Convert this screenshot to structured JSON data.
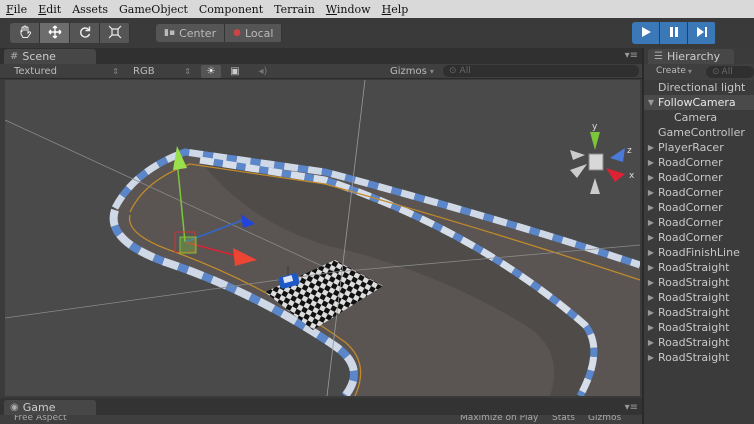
{
  "menu": [
    {
      "key": "F",
      "rest": "ile"
    },
    {
      "key": "E",
      "rest": "dit"
    },
    {
      "key": "",
      "rest": "Assets"
    },
    {
      "key": "",
      "rest": "GameObject"
    },
    {
      "key": "",
      "rest": "Component"
    },
    {
      "key": "",
      "rest": "Terrain"
    },
    {
      "key": "W",
      "rest": "indow"
    },
    {
      "key": "H",
      "rest": "elp"
    }
  ],
  "toolbar": {
    "tools": [
      "hand-icon",
      "move-icon",
      "rotate-icon",
      "scale-icon"
    ],
    "active_tool": "move-icon",
    "pivot": {
      "center_label": "Center",
      "local_label": "Local"
    },
    "play_controls": [
      "play-icon",
      "pause-icon",
      "step-icon"
    ],
    "accent": "#3a78b8"
  },
  "scene": {
    "tab_label": "Scene",
    "render_mode": "Textured",
    "color_mode": "RGB",
    "gizmos_label": "Gizmos",
    "search_placeholder": "All"
  },
  "hierarchy": {
    "tab_label": "Hierarchy",
    "create_label": "Create",
    "search_placeholder": "All",
    "items": [
      {
        "label": "Directional light",
        "arrow": "",
        "indent": 0
      },
      {
        "label": "FollowCamera",
        "arrow": "▼",
        "indent": 0,
        "selected": true
      },
      {
        "label": "Camera",
        "arrow": "",
        "indent": 1
      },
      {
        "label": "GameController",
        "arrow": "",
        "indent": 0
      },
      {
        "label": "PlayerRacer",
        "arrow": "▶",
        "indent": 0
      },
      {
        "label": "RoadCorner",
        "arrow": "▶",
        "indent": 0
      },
      {
        "label": "RoadCorner",
        "arrow": "▶",
        "indent": 0
      },
      {
        "label": "RoadCorner",
        "arrow": "▶",
        "indent": 0
      },
      {
        "label": "RoadCorner",
        "arrow": "▶",
        "indent": 0
      },
      {
        "label": "RoadCorner",
        "arrow": "▶",
        "indent": 0
      },
      {
        "label": "RoadCorner",
        "arrow": "▶",
        "indent": 0
      },
      {
        "label": "RoadFinishLine",
        "arrow": "▶",
        "indent": 0
      },
      {
        "label": "RoadStraight",
        "arrow": "▶",
        "indent": 0
      },
      {
        "label": "RoadStraight",
        "arrow": "▶",
        "indent": 0
      },
      {
        "label": "RoadStraight",
        "arrow": "▶",
        "indent": 0
      },
      {
        "label": "RoadStraight",
        "arrow": "▶",
        "indent": 0
      },
      {
        "label": "RoadStraight",
        "arrow": "▶",
        "indent": 0
      },
      {
        "label": "RoadStraight",
        "arrow": "▶",
        "indent": 0
      },
      {
        "label": "RoadStraight",
        "arrow": "▶",
        "indent": 0
      }
    ]
  },
  "game": {
    "tab_label": "Game",
    "aspect_label": "Free Aspect",
    "maximize_label": "Maximize on Play",
    "stats_label": "Stats",
    "gizmos_label": "Gizmos"
  },
  "gizmo": {
    "y_label": "y",
    "x_label": "x",
    "z_label": "z"
  }
}
